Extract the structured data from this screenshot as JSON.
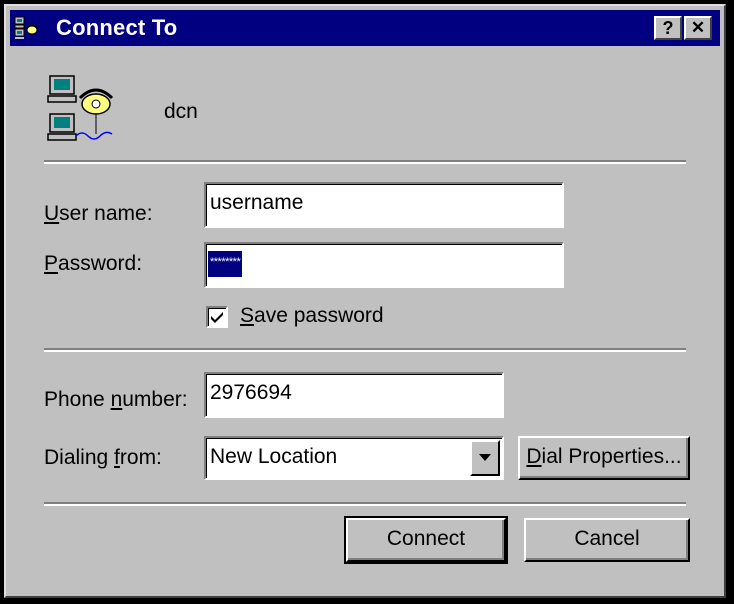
{
  "window": {
    "title": "Connect To",
    "help_label": "?",
    "close_label": "✕"
  },
  "connection": {
    "name": "dcn",
    "icon": "dialup-connection-icon"
  },
  "form": {
    "username_label_u": "U",
    "username_label_rest": "ser name:",
    "username_value": "username",
    "password_label_u": "P",
    "password_label_rest": "assword:",
    "password_value": "********",
    "save_password_u": "S",
    "save_password_rest": "ave password",
    "save_password_checked": true,
    "phone_label_pre": "Phone ",
    "phone_label_u": "n",
    "phone_label_rest": "umber:",
    "phone_value": "2976694",
    "dialing_label_pre": "Dialing ",
    "dialing_label_u": "f",
    "dialing_label_rest": "rom:",
    "dialing_value": "New Location",
    "dial_properties_u": "D",
    "dial_properties_rest": "ial Properties..."
  },
  "buttons": {
    "connect": "Connect",
    "cancel": "Cancel"
  },
  "colors": {
    "titlebar": "#000080",
    "face": "#c0c0c0",
    "selection": "#000080"
  }
}
